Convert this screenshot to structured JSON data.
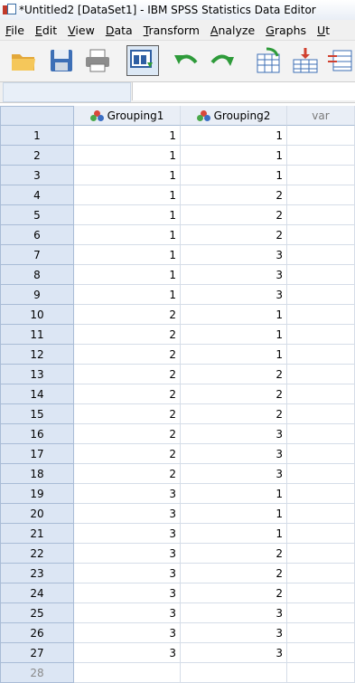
{
  "window": {
    "title": "*Untitled2 [DataSet1] - IBM SPSS Statistics Data Editor"
  },
  "menu": [
    {
      "label": "File",
      "ul": "F",
      "rest": "ile"
    },
    {
      "label": "Edit",
      "ul": "E",
      "rest": "dit"
    },
    {
      "label": "View",
      "ul": "V",
      "rest": "iew"
    },
    {
      "label": "Data",
      "ul": "D",
      "rest": "ata"
    },
    {
      "label": "Transform",
      "ul": "T",
      "rest": "ransform"
    },
    {
      "label": "Analyze",
      "ul": "A",
      "rest": "nalyze"
    },
    {
      "label": "Graphs",
      "ul": "G",
      "rest": "raphs"
    },
    {
      "label": "Ut",
      "ul": "U",
      "rest": "t"
    }
  ],
  "toolbar": {
    "icons": [
      "open-folder-icon",
      "save-disk-icon",
      "print-icon",
      "dialog-recall-icon",
      "undo-icon",
      "redo-icon",
      "goto-case-icon",
      "goto-variable-icon",
      "variables-icon"
    ],
    "active": "dialog-recall-icon"
  },
  "cell_editor": {
    "cell_reference": "",
    "cell_value": ""
  },
  "grid": {
    "columns": [
      {
        "name": "Grouping1",
        "icon": "nominal-measure-icon"
      },
      {
        "name": "Grouping2",
        "icon": "nominal-measure-icon"
      },
      {
        "name": "var",
        "icon": ""
      }
    ],
    "rows": [
      {
        "n": "1",
        "g1": "1",
        "g2": "1"
      },
      {
        "n": "2",
        "g1": "1",
        "g2": "1"
      },
      {
        "n": "3",
        "g1": "1",
        "g2": "1"
      },
      {
        "n": "4",
        "g1": "1",
        "g2": "2"
      },
      {
        "n": "5",
        "g1": "1",
        "g2": "2"
      },
      {
        "n": "6",
        "g1": "1",
        "g2": "2"
      },
      {
        "n": "7",
        "g1": "1",
        "g2": "3"
      },
      {
        "n": "8",
        "g1": "1",
        "g2": "3"
      },
      {
        "n": "9",
        "g1": "1",
        "g2": "3"
      },
      {
        "n": "10",
        "g1": "2",
        "g2": "1"
      },
      {
        "n": "11",
        "g1": "2",
        "g2": "1"
      },
      {
        "n": "12",
        "g1": "2",
        "g2": "1"
      },
      {
        "n": "13",
        "g1": "2",
        "g2": "2"
      },
      {
        "n": "14",
        "g1": "2",
        "g2": "2"
      },
      {
        "n": "15",
        "g1": "2",
        "g2": "2"
      },
      {
        "n": "16",
        "g1": "2",
        "g2": "3"
      },
      {
        "n": "17",
        "g1": "2",
        "g2": "3"
      },
      {
        "n": "18",
        "g1": "2",
        "g2": "3"
      },
      {
        "n": "19",
        "g1": "3",
        "g2": "1"
      },
      {
        "n": "20",
        "g1": "3",
        "g2": "1"
      },
      {
        "n": "21",
        "g1": "3",
        "g2": "1"
      },
      {
        "n": "22",
        "g1": "3",
        "g2": "2"
      },
      {
        "n": "23",
        "g1": "3",
        "g2": "2"
      },
      {
        "n": "24",
        "g1": "3",
        "g2": "2"
      },
      {
        "n": "25",
        "g1": "3",
        "g2": "3"
      },
      {
        "n": "26",
        "g1": "3",
        "g2": "3"
      },
      {
        "n": "27",
        "g1": "3",
        "g2": "3"
      },
      {
        "n": "28",
        "g1": "",
        "g2": ""
      }
    ]
  }
}
